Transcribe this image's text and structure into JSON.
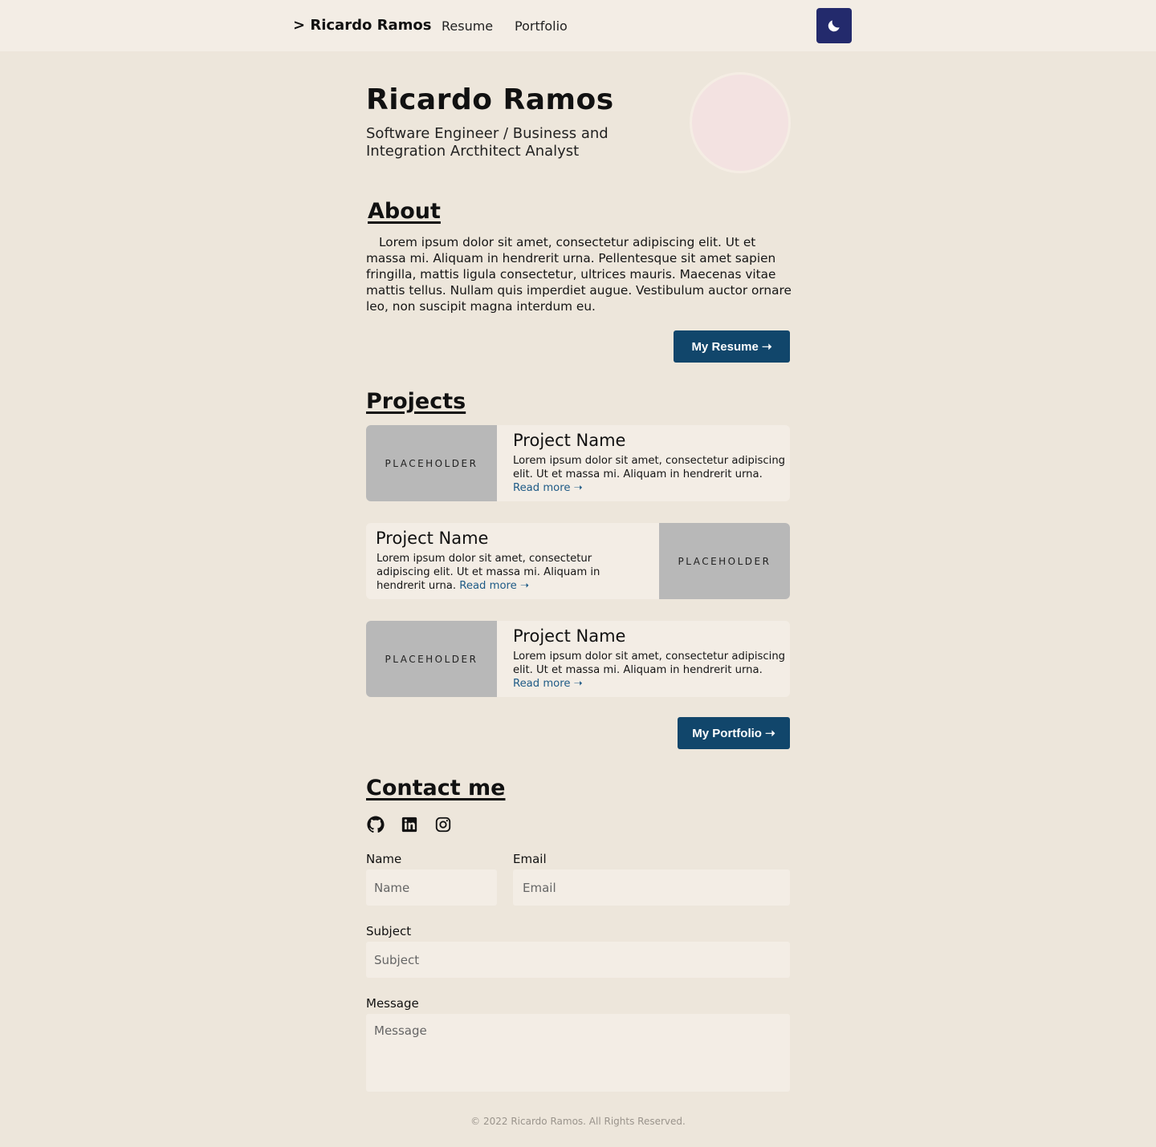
{
  "nav": {
    "brand": "> Ricardo Ramos",
    "links": [
      "Resume",
      "Portfolio"
    ],
    "theme_toggle_icon": "moon-icon"
  },
  "header": {
    "name": "Ricardo Ramos",
    "subtitle": "Software Engineer / Business and Integration Arcthitect Analyst"
  },
  "about": {
    "heading": "About",
    "text": "Lorem ipsum dolor sit amet, consectetur adipiscing elit. Ut et massa mi. Aliquam in hendrerit urna. Pellentesque sit amet sapien fringilla, mattis ligula consectetur, ultrices mauris. Maecenas vitae mattis tellus. Nullam quis imperdiet augue. Vestibulum auctor ornare leo, non suscipit magna interdum eu.",
    "button": "My Resume ➝"
  },
  "projects": {
    "heading": "Projects",
    "items": [
      {
        "title": "Project Name",
        "desc": "Lorem ipsum dolor sit amet, consectetur adipiscing elit. Ut et massa mi. Aliquam in hendrerit urna. ",
        "read_more": "Read more ➝",
        "placeholder": "PLACEHOLDER"
      },
      {
        "title": "Project Name",
        "desc": "Lorem ipsum dolor sit amet, consectetur adipiscing elit. Ut et massa mi. Aliquam in hendrerit urna. ",
        "read_more": "Read more ➝",
        "placeholder": "PLACEHOLDER"
      },
      {
        "title": "Project Name",
        "desc": "Lorem ipsum dolor sit amet, consectetur adipiscing elit. Ut et massa mi. Aliquam in hendrerit urna. ",
        "read_more": "Read more ➝",
        "placeholder": "PLACEHOLDER"
      }
    ],
    "button": "My Portfolio ➝"
  },
  "contact": {
    "heading": "Contact me",
    "social_icons": [
      "github-icon",
      "linkedin-icon",
      "instagram-icon"
    ],
    "name_label": "Name",
    "name_placeholder": "Name",
    "email_label": "Email",
    "email_placeholder": "Email",
    "subject_label": "Subject",
    "subject_placeholder": "Subject",
    "message_label": "Message",
    "message_placeholder": "Message"
  },
  "footer": {
    "text": "© 2022 Ricardo Ramos. All Rights Reserved."
  },
  "colors": {
    "background": "#ede6db",
    "surface": "#f3ede5",
    "primary_button": "#11466b",
    "theme_toggle": "#232a6c",
    "placeholder_image": "#b8b8b8",
    "link": "#1e5a86"
  }
}
